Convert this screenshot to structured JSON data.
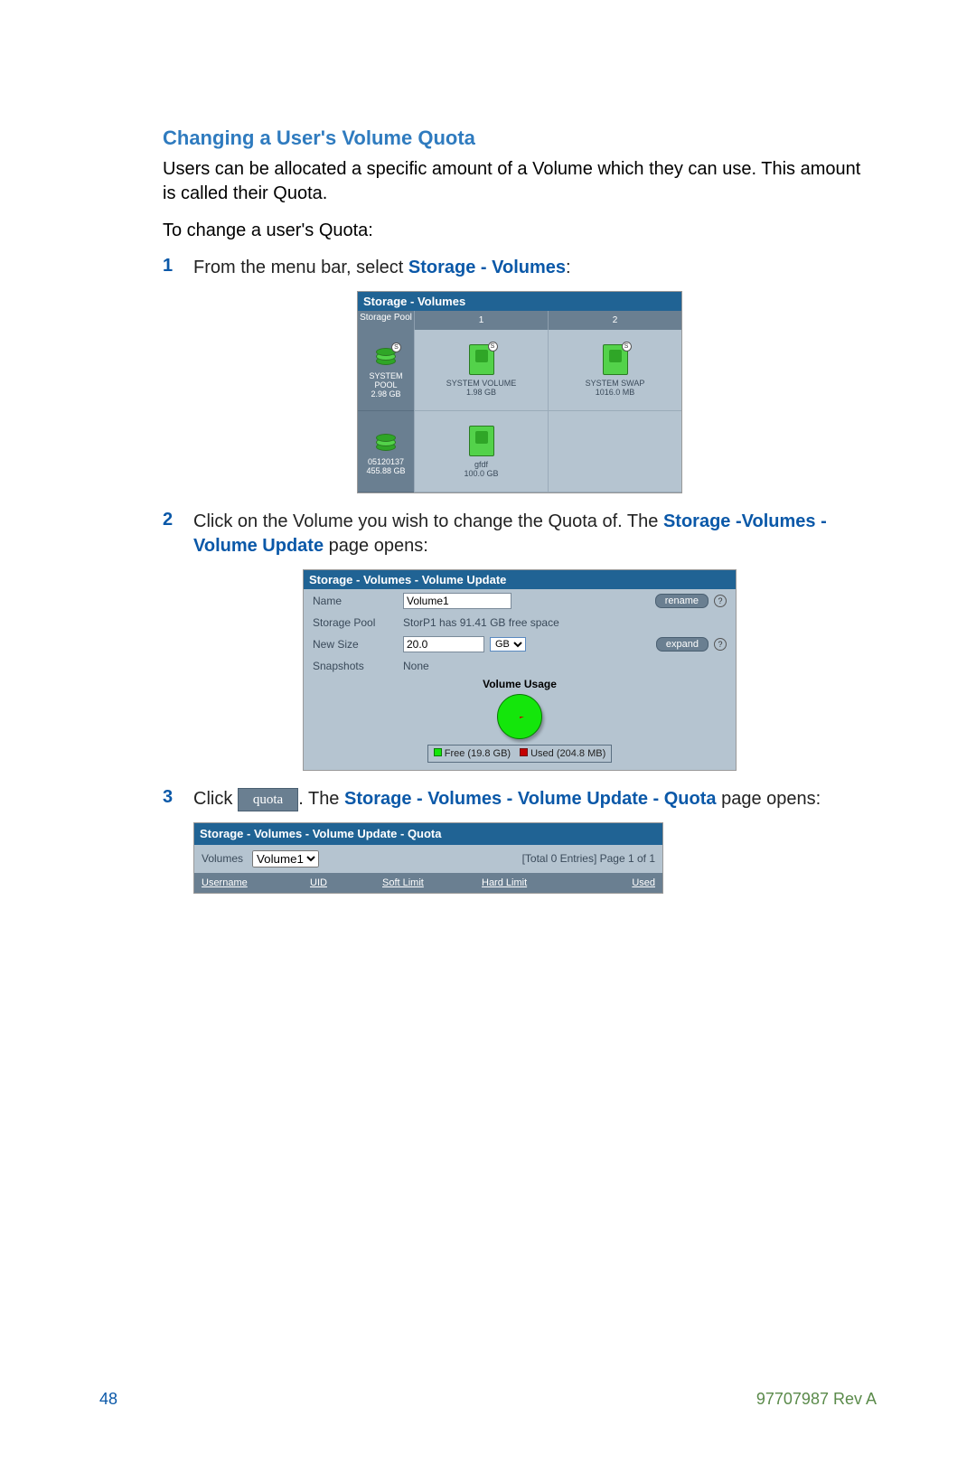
{
  "heading": "Changing a User's Volume Quota",
  "intro": "Users can be allocated a specific amount of a Volume which they can use. This amount is called their Quota.",
  "lead": "To change a user's Quota:",
  "steps": {
    "s1_num": "1",
    "s1_a": "From the menu bar, select ",
    "s1_b": "Storage - Volumes",
    "s1_c": ":",
    "s2_num": "2",
    "s2_a": "Click on the Volume you wish to change the Quota of. The ",
    "s2_b": "Storage -Volumes - Volume Update",
    "s2_c": " page opens:",
    "s3_num": "3",
    "s3_a": "Click ",
    "s3_b": ". The ",
    "s3_c": "Storage - Volumes - Volume Update - Quota",
    "s3_d": " page opens:"
  },
  "ss1": {
    "title": "Storage - Volumes",
    "pool_header": "Storage Pool",
    "col1": "1",
    "col2": "2",
    "pool1_name": "SYSTEM POOL",
    "pool1_size": "2.98 GB",
    "pool2_name": "05120137",
    "pool2_size": "455.88 GB",
    "vol1_name": "SYSTEM VOLUME",
    "vol1_size": "1.98 GB",
    "vol2_name": "SYSTEM SWAP",
    "vol2_size": "1016.0 MB",
    "vol3_name": "gfdf",
    "vol3_size": "100.0 GB",
    "badge": "S"
  },
  "ss2": {
    "title": "Storage - Volumes - Volume Update",
    "name_lbl": "Name",
    "name_val": "Volume1",
    "rename": "rename",
    "pool_lbl": "Storage Pool",
    "pool_val": "StorP1 has 91.41 GB free space",
    "size_lbl": "New Size",
    "size_val": "20.0",
    "unit": "GB",
    "expand": "expand",
    "snap_lbl": "Snapshots",
    "snap_val": "None",
    "usage_title": "Volume Usage",
    "legend_free": "Free (19.8 GB)",
    "legend_used": "Used (204.8 MB)"
  },
  "quota_btn": "quota",
  "ss3": {
    "title": "Storage - Volumes - Volume Update - Quota",
    "vol_lbl": "Volumes",
    "vol_sel": "Volume1",
    "entries": "[Total 0 Entries] Page 1 of 1",
    "h1": "Username",
    "h2": "UID",
    "h3": "Soft Limit",
    "h4": "Hard Limit",
    "h5": "Used"
  },
  "footer": {
    "page": "48",
    "rev": "97707987 Rev A"
  }
}
